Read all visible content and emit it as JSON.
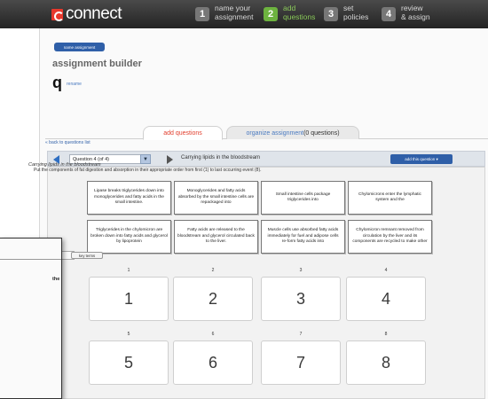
{
  "header": {
    "logo": "connect",
    "steps": [
      {
        "num": "1",
        "line1": "name your",
        "line2": "assignment",
        "active": false
      },
      {
        "num": "2",
        "line1": "add",
        "line2": "questions",
        "active": true
      },
      {
        "num": "3",
        "line1": "set",
        "line2": "policies",
        "active": false
      },
      {
        "num": "4",
        "line1": "review",
        "line2": "& assign",
        "active": false
      }
    ]
  },
  "builder": {
    "name_button": "name assignment",
    "title": "assignment builder",
    "assignment_name": "q",
    "rename": "rename"
  },
  "tabs": {
    "add": "add questions",
    "organize": "organize assignment",
    "organize_count": "(0 questions)"
  },
  "back_link": "« back to questions list",
  "question_bar": {
    "selected": "Question 4 (of 4)",
    "title": "Carrying lipids in the bloodstream",
    "add_button": "add this question"
  },
  "question": {
    "heading": "Carrying lipids in the bloodstream",
    "instructions": "Put the components of fat digestion and absorption in their appropriate order from first (1) to last occurring event (8)."
  },
  "cards": [
    "Lipase breaks triglycerides down into monoglycerides and fatty acids in the small intestine.",
    "Monoglycerides and fatty acids absorbed by the small intestine cells are repackaged into",
    "Small intestine cells package triglycerides into",
    "Chylomicrons enter the lymphatic system and the",
    "Triglycerides in the chylomicron are broken down into fatty acids and glycerol by lipoprotein",
    "Fatty acids are released to the bloodstream and glycerol circulated back to the liver.",
    "Muscle cells use absorbed fatty acids immediately for fuel and adipose cells re-form fatty acids into",
    "Chylomicron remnant removed from circulation by the liver and its components are recycled to make other"
  ],
  "slots": [
    "1",
    "2",
    "3",
    "4",
    "5",
    "6",
    "7",
    "8"
  ],
  "overlay": {
    "button": "key terms",
    "text1": "the"
  }
}
